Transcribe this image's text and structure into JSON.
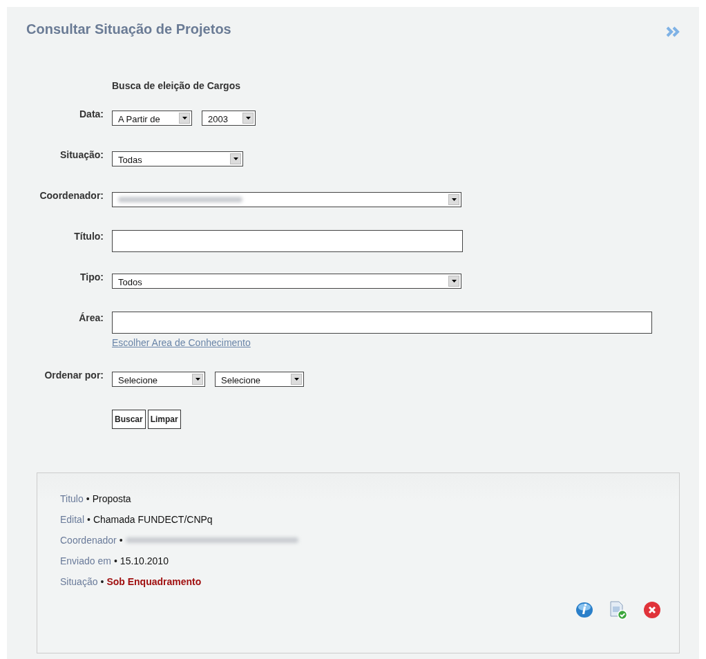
{
  "title": "Consultar Situação de Projetos",
  "form": {
    "heading": "Busca de eleição de Cargos",
    "fields": [
      {
        "label": "Data:",
        "kind": "selects",
        "selects": [
          {
            "value": "A Partir de"
          },
          {
            "value": "2003"
          }
        ]
      },
      {
        "label": "Situação:",
        "kind": "selects",
        "selects": [
          {
            "value": "Todas"
          }
        ]
      },
      {
        "label": "Coordenador:",
        "kind": "selects",
        "selects": [
          {
            "kind": "blurred"
          }
        ]
      },
      {
        "label": "Título:",
        "kind": "text"
      },
      {
        "label": "Tipo:",
        "kind": "selects",
        "selects": [
          {
            "value": "Todos"
          }
        ]
      },
      {
        "label": "Área:",
        "kind": "text",
        "link": "Escolher Area de Conhecimento"
      },
      {
        "label": "Ordenar por:",
        "kind": "selects",
        "selects": [
          {
            "value": "Selecione"
          },
          {
            "value": "Selecione"
          }
        ]
      }
    ],
    "buttons": [
      "Buscar",
      "Limpar"
    ]
  },
  "result": {
    "rows": [
      {
        "label": "Titulo",
        "separator": "•",
        "kind": "text",
        "value": "Proposta"
      },
      {
        "label": "Edital",
        "separator": "•",
        "kind": "text",
        "value": "Chamada FUNDECT/CNPq"
      },
      {
        "label": "Coordenador",
        "separator": "•",
        "kind": "blurred"
      },
      {
        "label": "Enviado em",
        "separator": "•",
        "kind": "text",
        "value": "15.10.2010"
      },
      {
        "label": "Situação",
        "separator": "•",
        "kind": "status",
        "value": "Sob Enquadramento"
      }
    ],
    "actions": [
      {
        "kind": "info"
      },
      {
        "kind": "approve"
      },
      {
        "kind": "delete"
      }
    ]
  }
}
